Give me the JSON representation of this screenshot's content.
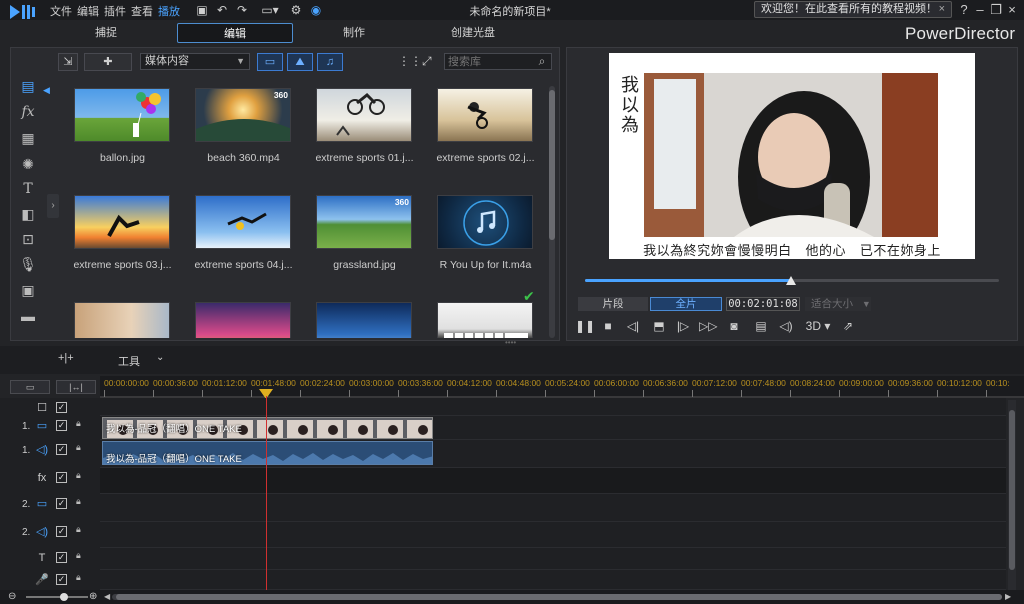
{
  "menu": [
    "文件",
    "编辑",
    "插件",
    "查看",
    "播放"
  ],
  "project_title": "未命名的新项目*",
  "welcome_message": "欢迎您！在此查看所有的教程视频！",
  "tabs": [
    "捕捉",
    "编辑",
    "制作",
    "创建光盘"
  ],
  "brand": "PowerDirector",
  "library": {
    "media_dropdown": "媒体内容",
    "search_placeholder": "搜索库",
    "items": [
      {
        "label": "ballon.jpg",
        "badge": ""
      },
      {
        "label": "beach 360.mp4",
        "badge": "360"
      },
      {
        "label": "extreme sports 01.j...",
        "badge": ""
      },
      {
        "label": "extreme sports 02.j...",
        "badge": ""
      },
      {
        "label": "extreme sports 03.j...",
        "badge": ""
      },
      {
        "label": "extreme sports 04.j...",
        "badge": ""
      },
      {
        "label": "grassland.jpg",
        "badge": "360"
      },
      {
        "label": "R You Up for It.m4a",
        "badge": ""
      },
      {
        "label": "",
        "badge": ""
      },
      {
        "label": "",
        "badge": ""
      },
      {
        "label": "",
        "badge": ""
      },
      {
        "label": "",
        "badge": ""
      }
    ]
  },
  "preview": {
    "title_vertical": "我以為",
    "subtitle": "我以為終究妳會慢慢明白   他的心   已不在妳身上",
    "mode_clip": "片段",
    "mode_full": "全片",
    "timecode": "00:02:01:08",
    "fit": "适合大小",
    "label_3d": "3D"
  },
  "timeline": {
    "tools_label": "工具",
    "ruler_labels": [
      "00:00:00:00",
      "00:00:36:00",
      "00:01:12:00",
      "00:01:48:00",
      "00:02:24:00",
      "00:03:00:00",
      "00:03:36:00",
      "00:04:12:00",
      "00:04:48:00",
      "00:05:24:00",
      "00:06:00:00",
      "00:06:36:00",
      "00:07:12:00",
      "00:07:48:00",
      "00:08:24:00",
      "00:09:00:00",
      "00:09:36:00",
      "00:10:12:00",
      "00:10:"
    ],
    "tracks": [
      {
        "num": "",
        "icon": "☐"
      },
      {
        "num": "1.",
        "icon": "▭"
      },
      {
        "num": "1.",
        "icon": "◁)"
      },
      {
        "num": "",
        "icon": "fx"
      },
      {
        "num": "2.",
        "icon": "▭"
      },
      {
        "num": "2.",
        "icon": "◁)"
      },
      {
        "num": "",
        "icon": "T"
      },
      {
        "num": "",
        "icon": "🎤"
      }
    ],
    "video_clip_label": "我以為-品冠（翻唱）ONE TAKE",
    "audio_clip_label": "我以為-品冠（翻唱）ONE TAKE"
  },
  "colors": {
    "accent": "#4aa3ff",
    "playhead": "#d03030",
    "ruler_text": "#b8901e"
  }
}
